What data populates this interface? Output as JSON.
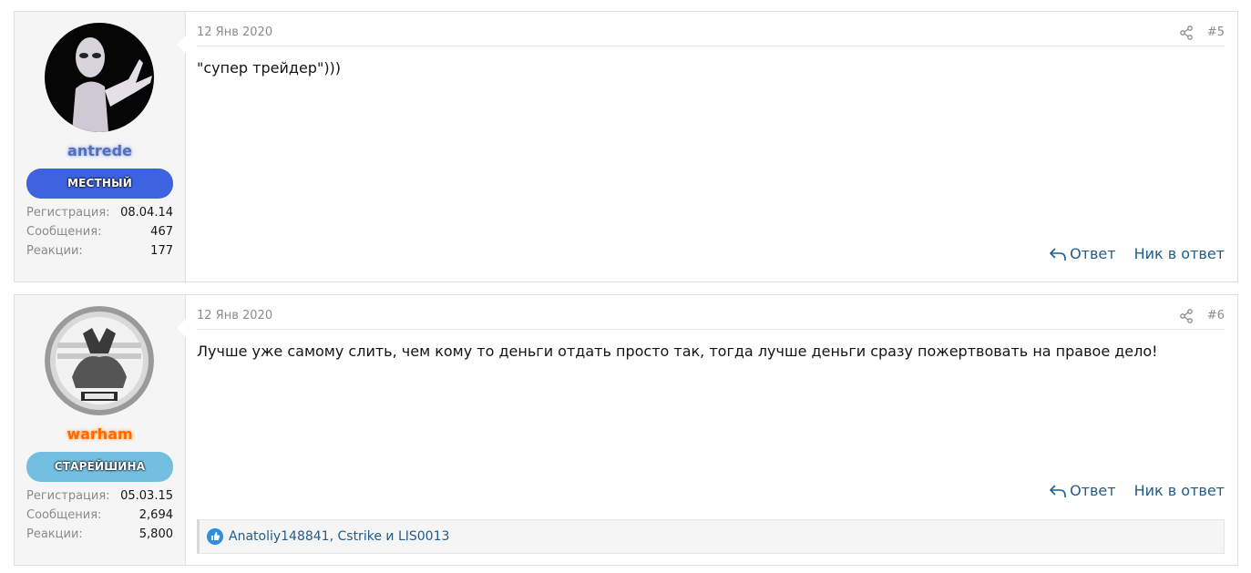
{
  "posts": [
    {
      "user": {
        "name": "antrede",
        "title": "МЕСТНЫЙ",
        "stats": [
          {
            "label": "Регистрация:",
            "value": "08.04.14"
          },
          {
            "label": "Сообщения:",
            "value": "467"
          },
          {
            "label": "Реакции:",
            "value": "177"
          }
        ]
      },
      "date": "12 Янв 2020",
      "number": "#5",
      "body": "\"супер трейдер\")))",
      "actions": {
        "reply": "Ответ",
        "quote_nick": "Ник в ответ"
      }
    },
    {
      "user": {
        "name": "warham",
        "title": "СТАРЕЙШИНА",
        "stats": [
          {
            "label": "Регистрация:",
            "value": "05.03.15"
          },
          {
            "label": "Сообщения:",
            "value": "2,694"
          },
          {
            "label": "Реакции:",
            "value": "5,800"
          }
        ]
      },
      "date": "12 Янв 2020",
      "number": "#6",
      "body": "Лучше уже самому слить, чем кому то деньги отдать просто так, тогда лучше деньги сразу пожертвовать на правое дело!",
      "actions": {
        "reply": "Ответ",
        "quote_nick": "Ник в ответ"
      },
      "reactions": {
        "users": [
          "Anatoliy148841",
          "Cstrike",
          "LIS0013"
        ],
        "separator": ", ",
        "conjunction": " и ",
        "icon": "like-icon"
      }
    }
  ],
  "colors": {
    "link": "#1f5c8b",
    "title_local": "#3d63e0",
    "title_elder": "#73bfe1",
    "username_antrede": "#5470b9",
    "username_warham": "#ff6a00"
  }
}
